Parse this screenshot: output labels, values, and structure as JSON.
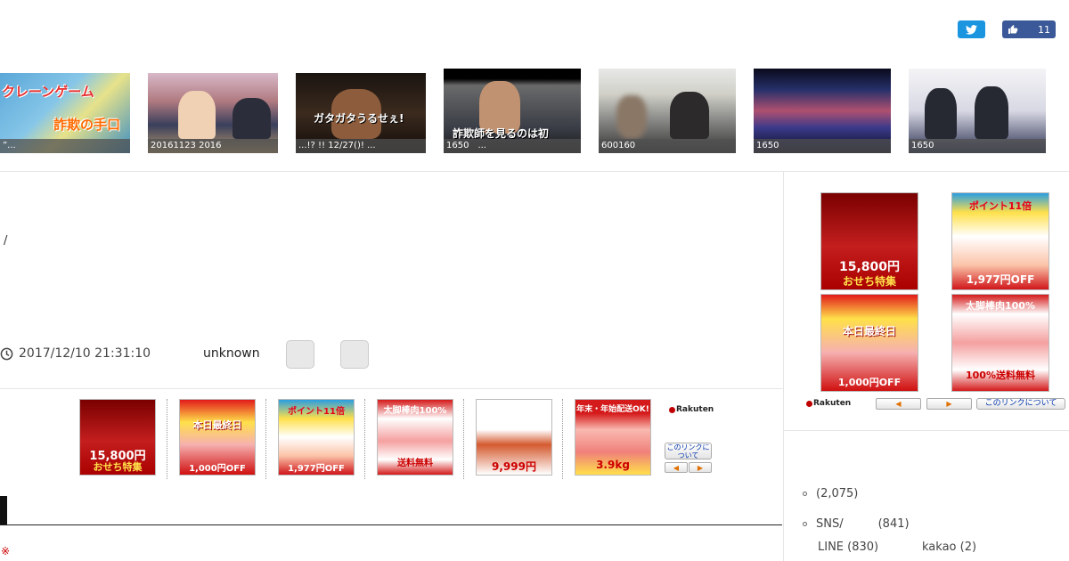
{
  "share": {
    "facebook_count": "11"
  },
  "thumbnails": [
    {
      "caption": "”...",
      "overlay": "クレーンゲーム",
      "overlay2": "詐欺の手口"
    },
    {
      "caption": "20161123 2016",
      "overlay": "",
      "overlay2": ""
    },
    {
      "caption": "...!? !! 12/27()! ...",
      "overlay": "ガタガタうるせぇ!",
      "overlay2": ""
    },
    {
      "caption": "1650　...",
      "overlay": "詐欺師を見るのは初",
      "overlay2": ""
    },
    {
      "caption": "600160",
      "overlay": "",
      "overlay2": ""
    },
    {
      "caption": "1650",
      "overlay": "",
      "overlay2": ""
    },
    {
      "caption": "1650",
      "overlay": "",
      "overlay2": ""
    }
  ],
  "article": {
    "slash": "/",
    "date": "2017/12/10 21:31:10",
    "author": "unknown"
  },
  "ads": [
    {
      "line1": "15,800円",
      "line2": "おせち特集"
    },
    {
      "line1": "本日最終日",
      "line2": "1,000円OFF"
    },
    {
      "line1": "ポイント11倍",
      "line2": "1,977円OFF"
    },
    {
      "line1": "太脚棒肉100%",
      "line2": "送料無料"
    },
    {
      "line1": "9,999円",
      "line2": ""
    },
    {
      "line1": "年末・年始配送OK!",
      "line2": "3.9kg"
    }
  ],
  "rakuten": {
    "logo": "Rakuten",
    "about_link": "このリンクについて",
    "about_link_side": "このリンクについて"
  },
  "sidebar_ads": [
    {
      "line1": "15,800円",
      "line2": "おせち特集"
    },
    {
      "line1": "ポイント11倍",
      "line2": "1,977円OFF"
    },
    {
      "line1": "本日最終日",
      "line2": "1,000円OFF"
    },
    {
      "line1": "太脚棒肉100%",
      "line2": "100%送料無料"
    }
  ],
  "sidebar_list": [
    {
      "label": "(2,075)"
    },
    {
      "label": "SNS/　　　(841)"
    }
  ],
  "sidebar_sub": {
    "line": "LINE (830)",
    "kakao": "kakao (2)"
  }
}
